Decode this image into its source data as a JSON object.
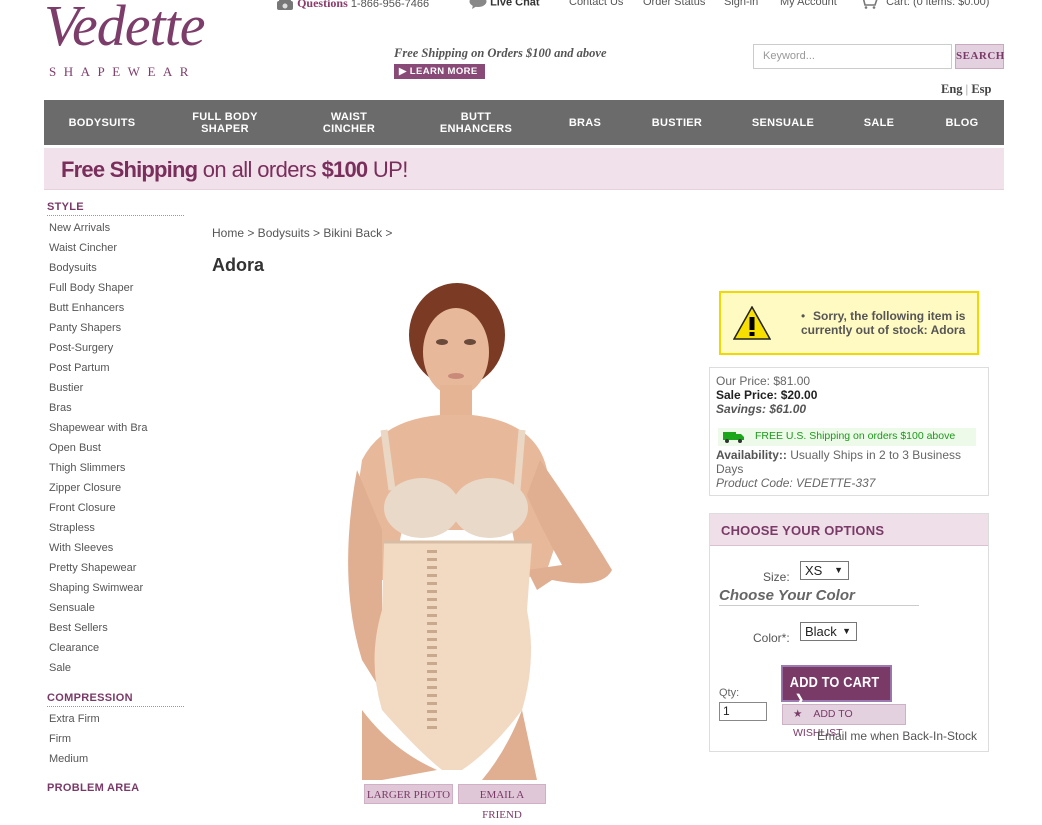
{
  "header": {
    "logo_script": "Vedette",
    "logo_sub": "SHAPEWEAR",
    "questions_label": "Questions",
    "phone": "1-866-956-7466",
    "live_chat": "Live Chat",
    "contact_us": "Contact Us",
    "order_status": "Order Status",
    "sign_in": "Sign-in",
    "my_account": "My Account",
    "cart": "Cart: (0 items: $0.00)",
    "free_shipping": "Free Shipping on Orders $100 and above",
    "learn_more": "LEARN MORE",
    "search_placeholder": "Keyword...",
    "search_button": "SEARCH",
    "lang_en": "Eng",
    "lang_sep": "|",
    "lang_es": "Esp"
  },
  "nav": {
    "items": [
      {
        "l1": "BODYSUITS",
        "l2": ""
      },
      {
        "l1": "FULL BODY",
        "l2": "SHAPER"
      },
      {
        "l1": "WAIST",
        "l2": "CINCHER"
      },
      {
        "l1": "BUTT",
        "l2": "ENHANCERS"
      },
      {
        "l1": "BRAS",
        "l2": ""
      },
      {
        "l1": "BUSTIER",
        "l2": ""
      },
      {
        "l1": "SENSUALE",
        "l2": ""
      },
      {
        "l1": "SALE",
        "l2": ""
      },
      {
        "l1": "BLOG",
        "l2": ""
      }
    ]
  },
  "banner": {
    "part1": "Free Shipping",
    "part2": " on all orders ",
    "part3": "$100",
    "part4": " UP!"
  },
  "sidebar": {
    "style_title": "STYLE",
    "style_items": [
      "New Arrivals",
      "Waist Cincher",
      "Bodysuits",
      "Full Body Shaper",
      "Butt Enhancers",
      "Panty Shapers",
      "Post-Surgery",
      "Post Partum",
      "Bustier",
      "Bras",
      "Shapewear with Bra",
      "Open Bust",
      "Thigh Slimmers",
      "Zipper Closure",
      "Front Closure",
      "Strapless",
      "With Sleeves",
      "Pretty Shapewear",
      "Shaping Swimwear",
      "Sensuale",
      "Best Sellers",
      "Clearance",
      "Sale"
    ],
    "compression_title": "COMPRESSION",
    "compression_items": [
      "Extra Firm",
      "Firm",
      "Medium"
    ],
    "problem_title": "PROBLEM AREA"
  },
  "product": {
    "breadcrumb": "Home > Bodysuits > Bikini Back >",
    "title": "Adora",
    "larger_photo": "LARGER PHOTO",
    "email_friend": "EMAIL A FRIEND",
    "stock_alert": "Sorry, the following item is currently out of stock: Adora",
    "our_price": "Our Price: $81.00",
    "sale_price": "Sale Price: $20.00",
    "savings": "Savings: $61.00",
    "free_ship": "FREE U.S. Shipping on orders $100 above",
    "availability_label": "Availability::",
    "availability_value": " Usually Ships in 2 to 3 Business Days",
    "product_code_label": "Product Code: ",
    "product_code": "VEDETTE-337"
  },
  "options": {
    "title": "CHOOSE YOUR OPTIONS",
    "size_label": "Size:",
    "size_value": "XS",
    "choose_color": "Choose Your Color",
    "color_label": "Color*:",
    "color_value": "Black",
    "qty_label": "Qty:",
    "qty_value": "1",
    "add_to_cart": "ADD TO CART",
    "wishlist": "ADD TO WISHLIST",
    "back_in_stock": "Email me when Back-In-Stock"
  },
  "colors": {
    "brand": "#7a3a68",
    "nav_bg": "#6b6b6b",
    "banner_bg": "#f1e1ea",
    "alert_bg": "#fff9c2",
    "alert_border": "#f0d800",
    "ship_green": "#1a9a1a"
  }
}
